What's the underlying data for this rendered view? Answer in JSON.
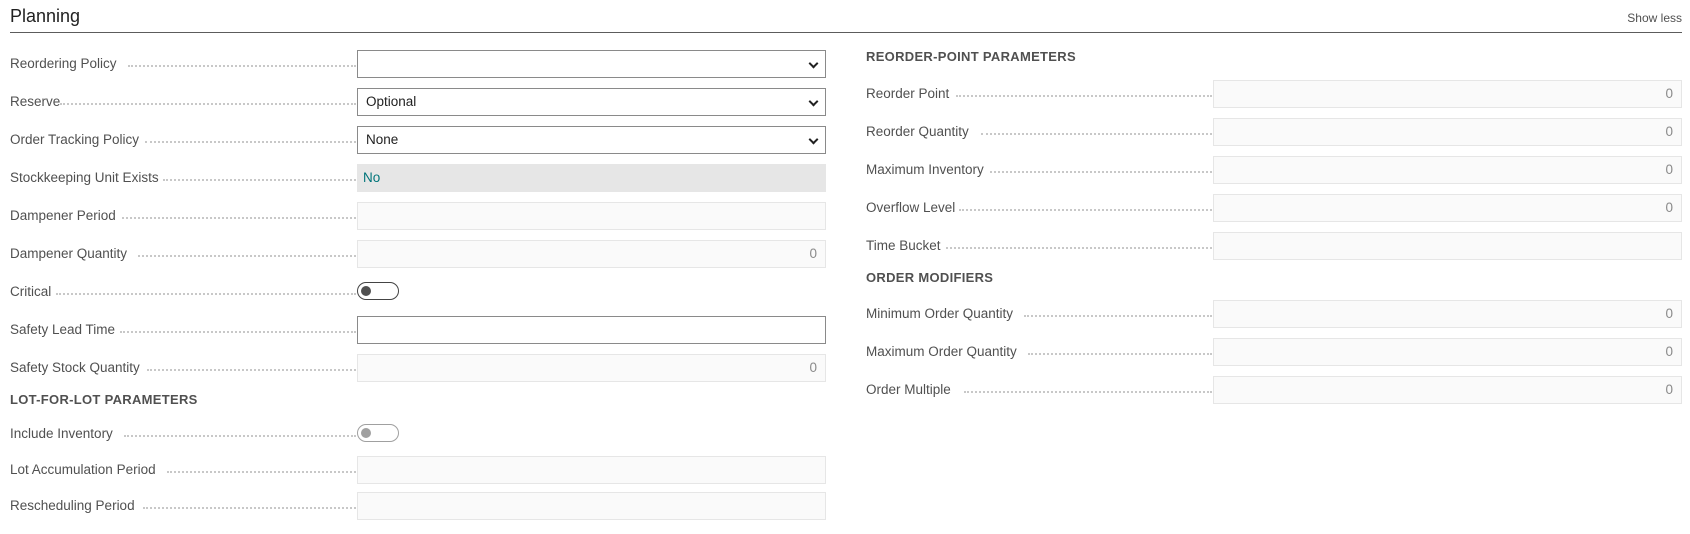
{
  "header": {
    "title": "Planning",
    "show_less": "Show less"
  },
  "left": {
    "reordering_policy": {
      "label": "Reordering Policy",
      "value": ""
    },
    "reserve": {
      "label": "Reserve",
      "value": "Optional"
    },
    "order_tracking_policy": {
      "label": "Order Tracking Policy",
      "value": "None"
    },
    "stockkeeping_unit_exists": {
      "label": "Stockkeeping Unit Exists",
      "value": "No"
    },
    "dampener_period": {
      "label": "Dampener Period",
      "value": ""
    },
    "dampener_quantity": {
      "label": "Dampener Quantity",
      "value": "0"
    },
    "critical": {
      "label": "Critical",
      "value": false
    },
    "safety_lead_time": {
      "label": "Safety Lead Time",
      "value": ""
    },
    "safety_stock_quantity": {
      "label": "Safety Stock Quantity",
      "value": "0"
    },
    "lot_section": "LOT-FOR-LOT PARAMETERS",
    "include_inventory": {
      "label": "Include Inventory",
      "value": false
    },
    "lot_accumulation_period": {
      "label": "Lot Accumulation Period",
      "value": ""
    },
    "rescheduling_period": {
      "label": "Rescheduling Period",
      "value": ""
    }
  },
  "right": {
    "reorder_section": "REORDER-POINT PARAMETERS",
    "reorder_point": {
      "label": "Reorder Point",
      "value": "0"
    },
    "reorder_quantity": {
      "label": "Reorder Quantity",
      "value": "0"
    },
    "maximum_inventory": {
      "label": "Maximum Inventory",
      "value": "0"
    },
    "overflow_level": {
      "label": "Overflow Level",
      "value": "0"
    },
    "time_bucket": {
      "label": "Time Bucket",
      "value": ""
    },
    "modifiers_section": "ORDER MODIFIERS",
    "minimum_order_quantity": {
      "label": "Minimum Order Quantity",
      "value": "0"
    },
    "maximum_order_quantity": {
      "label": "Maximum Order Quantity",
      "value": "0"
    },
    "order_multiple": {
      "label": "Order Multiple",
      "value": "0"
    }
  },
  "colors": {
    "accent_link": "#00757a",
    "border": "#8a8a8a",
    "readonly_bg": "#fafafa"
  }
}
